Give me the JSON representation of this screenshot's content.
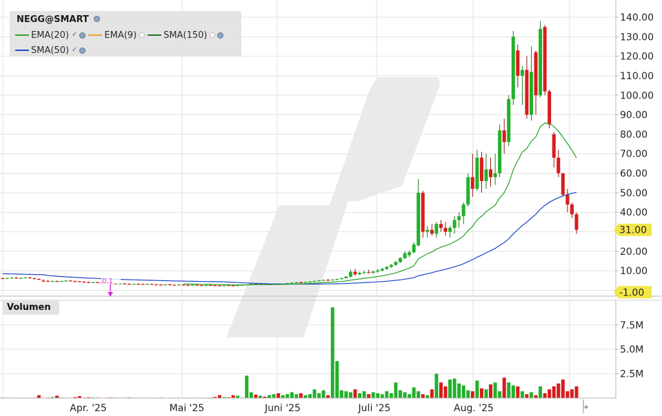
{
  "instrument": "NEGG@SMART",
  "legend": [
    {
      "label": "EMA(20)",
      "color": "#22a022",
      "check": true,
      "gear": true,
      "dot": false
    },
    {
      "label": "EMA(9)",
      "color": "#f0a030",
      "check": false,
      "gear": false,
      "dot": true
    },
    {
      "label": "SMA(150)",
      "color": "#1e6e1e",
      "check": false,
      "gear": true,
      "dot": true
    },
    {
      "label": "SMA(50)",
      "color": "#1a44c8",
      "check": true,
      "gear": true,
      "dot": false
    }
  ],
  "volume_label": "Volumen",
  "marker_label": "0.1",
  "colors": {
    "up": "#22b02a",
    "down": "#d81c1c",
    "ema20": "#22a022",
    "sma50": "#1a44c8",
    "price_tag": "#f2e64a",
    "marker": "#e030e0"
  },
  "chart_data": {
    "type": "candlestick",
    "price_axis": {
      "ticks": [
        "140.00",
        "130.00",
        "120.00",
        "110.00",
        "100.00",
        "90.00",
        "80.00",
        "70.00",
        "60.00",
        "50.00",
        "40.00",
        "30.00",
        "20.00",
        "10.00",
        "0.00"
      ],
      "ylim": [
        -2,
        146
      ]
    },
    "volume_axis": {
      "ticks": [
        "7.5M",
        "5.0M",
        "2.5M"
      ],
      "ylim": [
        0,
        9.6
      ]
    },
    "x_labels": [
      "Apr. '25",
      "Mai '25",
      "Juni '25",
      "Juli '25",
      "Aug. '25"
    ],
    "last_price_label": "31.00",
    "low_label": "-1.00",
    "candles": [
      [
        6.2,
        6.5,
        5.7,
        6.0
      ],
      [
        6.1,
        6.4,
        5.7,
        6.3
      ],
      [
        6.3,
        6.8,
        6.0,
        6.5
      ],
      [
        6.5,
        6.8,
        6.0,
        6.1
      ],
      [
        6.1,
        6.5,
        5.8,
        6.3
      ],
      [
        6.3,
        6.7,
        6.1,
        6.6
      ],
      [
        6.6,
        6.8,
        6.0,
        6.2
      ],
      [
        6.2,
        6.4,
        5.6,
        5.8
      ],
      [
        5.8,
        6.1,
        5.4,
        5.6
      ],
      [
        5.0,
        5.6,
        4.2,
        4.8
      ],
      [
        4.8,
        5.1,
        4.3,
        4.6
      ],
      [
        4.6,
        4.9,
        4.2,
        4.7
      ],
      [
        4.7,
        5.0,
        4.4,
        4.5
      ],
      [
        4.5,
        4.9,
        4.3,
        4.8
      ],
      [
        4.8,
        5.2,
        4.5,
        5.0
      ],
      [
        5.0,
        5.3,
        4.6,
        4.7
      ],
      [
        4.7,
        5.0,
        4.4,
        4.6
      ],
      [
        4.6,
        4.8,
        4.2,
        4.4
      ],
      [
        4.4,
        4.7,
        4.0,
        4.2
      ],
      [
        4.2,
        4.5,
        3.8,
        4.0
      ],
      [
        4.0,
        4.3,
        3.7,
        4.1
      ],
      [
        4.1,
        4.4,
        3.8,
        3.9
      ],
      [
        3.9,
        4.2,
        3.6,
        3.8
      ],
      [
        3.8,
        4.1,
        3.5,
        3.7
      ],
      [
        3.7,
        4.0,
        3.3,
        3.5
      ],
      [
        3.5,
        3.8,
        3.2,
        3.4
      ],
      [
        3.4,
        3.7,
        3.1,
        3.5
      ],
      [
        3.5,
        3.8,
        3.2,
        3.3
      ],
      [
        3.3,
        3.6,
        3.0,
        3.2
      ],
      [
        3.2,
        3.5,
        2.9,
        3.3
      ],
      [
        3.3,
        3.6,
        3.0,
        3.2
      ],
      [
        3.2,
        3.5,
        2.9,
        3.1
      ],
      [
        3.1,
        3.4,
        2.8,
        3.2
      ],
      [
        3.2,
        3.5,
        2.9,
        3.0
      ],
      [
        3.0,
        3.3,
        2.7,
        2.9
      ],
      [
        2.9,
        3.2,
        2.6,
        2.8
      ],
      [
        2.8,
        3.1,
        2.5,
        3.0
      ],
      [
        3.0,
        3.3,
        2.7,
        2.8
      ],
      [
        2.8,
        3.1,
        2.5,
        2.7
      ],
      [
        2.7,
        3.0,
        2.4,
        2.9
      ],
      [
        2.9,
        3.2,
        2.6,
        2.7
      ],
      [
        2.7,
        3.0,
        2.4,
        2.6
      ],
      [
        2.6,
        2.9,
        2.3,
        2.8
      ],
      [
        2.8,
        3.1,
        2.5,
        2.6
      ],
      [
        2.6,
        2.9,
        2.3,
        2.5
      ],
      [
        2.5,
        2.8,
        2.2,
        2.7
      ],
      [
        2.7,
        3.0,
        2.4,
        2.6
      ],
      [
        2.6,
        2.9,
        2.3,
        2.5
      ],
      [
        2.5,
        2.8,
        2.2,
        2.4
      ],
      [
        2.4,
        2.7,
        2.1,
        2.6
      ],
      [
        2.6,
        2.9,
        2.3,
        2.5
      ],
      [
        2.5,
        2.8,
        2.2,
        2.4
      ],
      [
        2.4,
        2.7,
        2.1,
        2.6
      ],
      [
        2.6,
        2.9,
        2.4,
        2.8
      ],
      [
        2.8,
        3.1,
        2.5,
        3.0
      ],
      [
        3.0,
        3.4,
        2.8,
        3.3
      ],
      [
        3.3,
        3.6,
        3.0,
        3.1
      ],
      [
        3.1,
        3.4,
        2.8,
        3.2
      ],
      [
        3.2,
        3.5,
        2.9,
        3.0
      ],
      [
        3.0,
        3.3,
        2.7,
        3.1
      ],
      [
        3.1,
        3.4,
        2.8,
        3.3
      ],
      [
        3.3,
        3.6,
        3.0,
        3.2
      ],
      [
        3.2,
        3.5,
        2.9,
        3.4
      ],
      [
        3.4,
        3.8,
        3.1,
        3.6
      ],
      [
        3.6,
        4.0,
        3.3,
        3.9
      ],
      [
        3.9,
        4.3,
        3.6,
        4.1
      ],
      [
        4.1,
        4.5,
        3.8,
        4.0
      ],
      [
        4.0,
        4.4,
        3.7,
        4.3
      ],
      [
        4.3,
        4.7,
        4.0,
        4.5
      ],
      [
        4.5,
        5.0,
        4.2,
        4.8
      ],
      [
        4.8,
        5.3,
        4.5,
        5.1
      ],
      [
        5.1,
        5.6,
        4.8,
        5.3
      ],
      [
        5.3,
        5.8,
        5.0,
        5.2
      ],
      [
        5.2,
        5.7,
        4.9,
        5.5
      ],
      [
        5.5,
        6.0,
        5.2,
        5.8
      ],
      [
        5.8,
        6.5,
        5.5,
        6.2
      ],
      [
        6.2,
        7.2,
        6.0,
        7.0
      ],
      [
        7.0,
        10.5,
        6.5,
        9.5
      ],
      [
        9.5,
        11.0,
        7.5,
        8.2
      ],
      [
        8.2,
        9.5,
        7.8,
        8.9
      ],
      [
        8.9,
        10.0,
        8.3,
        9.3
      ],
      [
        9.3,
        10.5,
        8.7,
        9.0
      ],
      [
        9.0,
        10.0,
        8.4,
        9.6
      ],
      [
        9.6,
        11.0,
        9.0,
        10.2
      ],
      [
        10.2,
        11.5,
        9.6,
        11.0
      ],
      [
        11.0,
        12.5,
        10.4,
        12.0
      ],
      [
        12.0,
        13.5,
        11.5,
        13.0
      ],
      [
        13.0,
        15.0,
        12.5,
        14.5
      ],
      [
        14.5,
        17.0,
        14.0,
        16.5
      ],
      [
        16.5,
        20.0,
        16.0,
        19.0
      ],
      [
        18.0,
        20.5,
        17.0,
        19.5
      ],
      [
        19.5,
        24.5,
        19.0,
        23.5
      ],
      [
        23.0,
        57.0,
        22.5,
        50.0
      ],
      [
        50.0,
        51.0,
        27.0,
        30.0
      ],
      [
        30.0,
        33.0,
        27.0,
        31.0
      ],
      [
        31.0,
        34.0,
        28.0,
        29.0
      ],
      [
        29.0,
        35.0,
        27.0,
        34.0
      ],
      [
        34.0,
        36.0,
        30.0,
        32.0
      ],
      [
        32.0,
        35.0,
        28.0,
        30.0
      ],
      [
        30.0,
        33.0,
        27.0,
        32.0
      ],
      [
        32.0,
        38.0,
        29.0,
        36.0
      ],
      [
        36.0,
        40.0,
        32.0,
        38.0
      ],
      [
        38.0,
        45.0,
        34.0,
        44.0
      ],
      [
        44.0,
        60.0,
        43.0,
        58.0
      ],
      [
        58.0,
        70.0,
        48.0,
        52.0
      ],
      [
        52.0,
        72.0,
        51.0,
        68.0
      ],
      [
        68.0,
        71.0,
        50.0,
        56.0
      ],
      [
        56.0,
        70.0,
        52.0,
        62.0
      ],
      [
        62.0,
        68.0,
        53.0,
        58.0
      ],
      [
        58.0,
        70.0,
        54.0,
        60.0
      ],
      [
        60.0,
        85.0,
        58.0,
        82.0
      ],
      [
        82.0,
        88.0,
        70.0,
        76.0
      ],
      [
        76.0,
        100.0,
        74.0,
        98.0
      ],
      [
        98.0,
        133.0,
        95.0,
        130.0
      ],
      [
        123.0,
        126.0,
        104.0,
        110.0
      ],
      [
        110.0,
        115.0,
        95.0,
        113.0
      ],
      [
        113.0,
        120.0,
        88.0,
        90.0
      ],
      [
        90.0,
        125.0,
        87.0,
        112.0
      ],
      [
        122.0,
        123.0,
        90.0,
        100.0
      ],
      [
        100.0,
        138.0,
        99.0,
        134.0
      ],
      [
        135.0,
        136.0,
        100.0,
        102.0
      ],
      [
        102.0,
        103.0,
        83.0,
        85.0
      ],
      [
        80.0,
        81.0,
        63.0,
        68.0
      ],
      [
        68.0,
        72.0,
        58.0,
        60.0
      ],
      [
        60.0,
        60.0,
        48.0,
        49.0
      ],
      [
        49.0,
        52.0,
        40.0,
        44.0
      ],
      [
        44.0,
        45.0,
        37.0,
        39.0
      ],
      [
        39.0,
        40.0,
        29.0,
        31.0
      ]
    ],
    "volumes_millions": [
      0.05,
      0.04,
      0.04,
      0.03,
      0.03,
      0.04,
      0.03,
      0.05,
      0.3,
      0.04,
      0.05,
      0.1,
      0.25,
      0.06,
      0.05,
      0.04,
      0.1,
      0.2,
      0.05,
      0.08,
      0.06,
      0.05,
      0.04,
      0.05,
      0.06,
      0.05,
      0.04,
      0.05,
      0.06,
      0.05,
      0.04,
      0.04,
      0.05,
      0.04,
      0.03,
      0.05,
      0.04,
      0.04,
      0.03,
      0.05,
      0.04,
      0.03,
      0.05,
      0.04,
      0.03,
      0.04,
      0.05,
      0.12,
      0.3,
      0.1,
      0.08,
      0.3,
      0.25,
      0.05,
      2.3,
      0.6,
      0.35,
      0.25,
      0.15,
      0.3,
      0.4,
      0.5,
      0.3,
      0.4,
      0.6,
      0.4,
      0.5,
      0.3,
      0.4,
      0.9,
      0.5,
      0.8,
      0.3,
      9.3,
      3.8,
      0.8,
      0.7,
      0.6,
      0.9,
      0.5,
      0.7,
      0.4,
      0.6,
      0.5,
      0.4,
      0.7,
      0.5,
      1.6,
      0.8,
      0.6,
      0.4,
      1.1,
      0.7,
      0.4,
      0.3,
      0.9,
      2.5,
      1.6,
      1.2,
      1.9,
      2.0,
      1.5,
      1.3,
      0.8,
      0.7,
      1.8,
      1.0,
      0.9,
      1.4,
      1.6,
      0.7,
      2.1,
      1.6,
      1.3,
      1.2,
      0.7,
      0.4,
      0.6,
      0.3,
      1.2,
      0.5,
      0.9,
      1.2,
      1.5,
      1.9,
      0.7,
      0.9,
      1.2
    ]
  }
}
